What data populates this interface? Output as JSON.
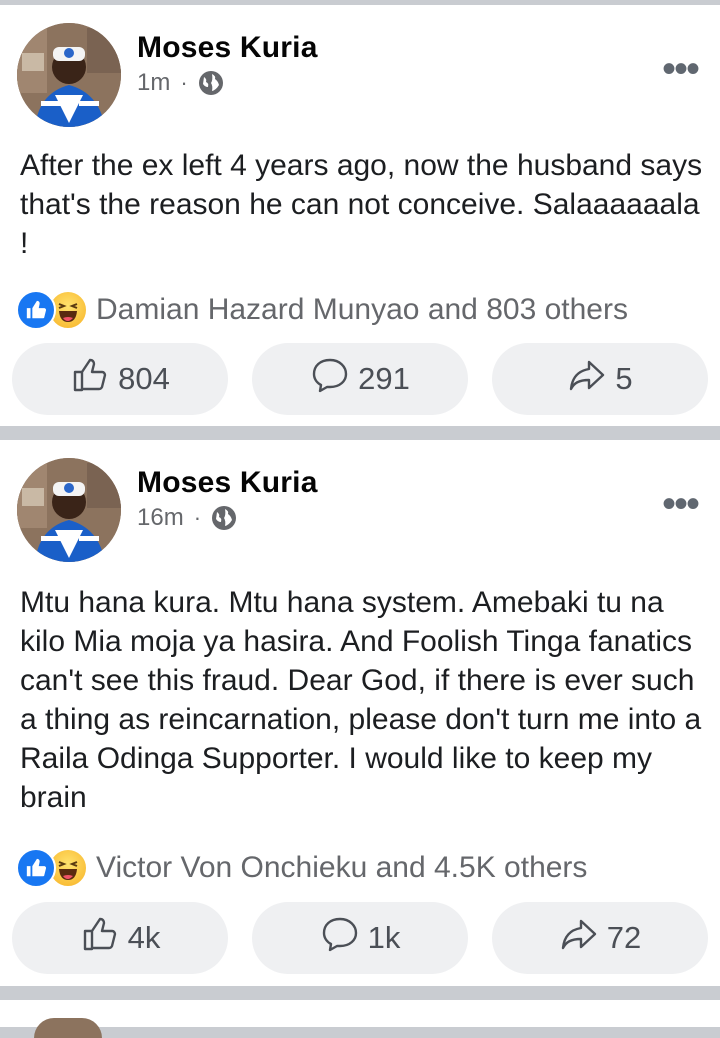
{
  "posts": [
    {
      "author": "Moses Kuria",
      "time": "1m",
      "separator": "·",
      "text": "After the ex left 4 years ago, now the husband says that's the reason he can not conceive. Salaaaaaala !",
      "reactions_text": "Damian Hazard Munyao and 803 others",
      "likes": "804",
      "comments": "291",
      "shares": "5"
    },
    {
      "author": "Moses Kuria",
      "time": "16m",
      "separator": "·",
      "text": "Mtu hana kura. Mtu hana system. Amebaki tu na kilo Mia moja ya hasira. And Foolish Tinga fanatics can't see this fraud. Dear God, if there is ever such a thing as reincarnation, please don't turn me into a Raila Odinga Supporter.  I would like to keep my brain",
      "reactions_text": "Victor Von Onchieku and 4.5K others",
      "likes": "4k",
      "comments": "1k",
      "shares": "72"
    }
  ],
  "icons": {
    "privacy": "globe-icon",
    "more": "more-options-icon",
    "like": "thumbs-up-icon",
    "comment": "comment-bubble-icon",
    "share": "share-arrow-icon",
    "reaction_like": "like-reaction-icon",
    "reaction_haha": "haha-reaction-icon"
  },
  "colors": {
    "background": "#c9ccd1",
    "card": "#ffffff",
    "like_blue": "#1877f2",
    "secondary_text": "#65676b",
    "button_bg": "#eff0f2"
  }
}
